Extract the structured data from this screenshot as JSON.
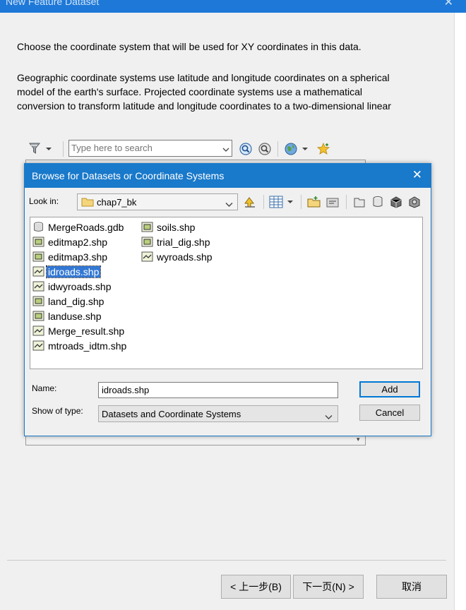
{
  "window": {
    "title": "New Feature Dataset",
    "close_glyph": "✕"
  },
  "intro": {
    "line1": "Choose the coordinate system that will be used for XY coordinates in this data.",
    "para2_line1": "Geographic coordinate systems use latitude and longitude coordinates on a spherical",
    "para2_line2": "model of the earth's surface. Projected coordinate systems use a mathematical",
    "para2_line3": "conversion to transform latitude and longitude coordinates to a two-dimensional linear"
  },
  "toolbar": {
    "search_placeholder": "Type here to search",
    "icons": [
      "filter-icon",
      "search-icon",
      "search-options-icon",
      "globe-icon",
      "favorites-icon"
    ]
  },
  "browse_dialog": {
    "title": "Browse for Datasets or Coordinate Systems",
    "close_glyph": "✕",
    "look_in_label": "Look in:",
    "look_in_value": "chap7_bk",
    "name_label": "Name:",
    "name_value": "idroads.shp",
    "type_label": "Show of type:",
    "type_value": "Datasets and Coordinate Systems",
    "add_button": "Add",
    "cancel_button": "Cancel",
    "files": [
      {
        "label": "MergeRoads.gdb",
        "icon": "geodatabase-icon",
        "selected": false
      },
      {
        "label": "editmap2.shp",
        "icon": "polygon-shapefile-icon",
        "selected": false
      },
      {
        "label": "editmap3.shp",
        "icon": "polygon-shapefile-icon",
        "selected": false
      },
      {
        "label": "idroads.shp",
        "icon": "line-shapefile-icon",
        "selected": true
      },
      {
        "label": "idwyroads.shp",
        "icon": "line-shapefile-icon",
        "selected": false
      },
      {
        "label": "land_dig.shp",
        "icon": "polygon-shapefile-icon",
        "selected": false
      },
      {
        "label": "landuse.shp",
        "icon": "polygon-shapefile-icon",
        "selected": false
      },
      {
        "label": "Merge_result.shp",
        "icon": "line-shapefile-icon",
        "selected": false
      },
      {
        "label": "mtroads_idtm.shp",
        "icon": "line-shapefile-icon",
        "selected": false
      },
      {
        "label": "soils.shp",
        "icon": "polygon-shapefile-icon",
        "selected": false
      },
      {
        "label": "trial_dig.shp",
        "icon": "polygon-shapefile-icon",
        "selected": false
      },
      {
        "label": "wyroads.shp",
        "icon": "line-shapefile-icon",
        "selected": false
      }
    ]
  },
  "wizard": {
    "back_button": "< 上一步(B)",
    "next_button": "下一页(N) >",
    "cancel_button": "取消"
  },
  "colors": {
    "title_blue": "#1979ca",
    "selection_blue": "#3378d4",
    "default_button_border": "#0078d7"
  }
}
